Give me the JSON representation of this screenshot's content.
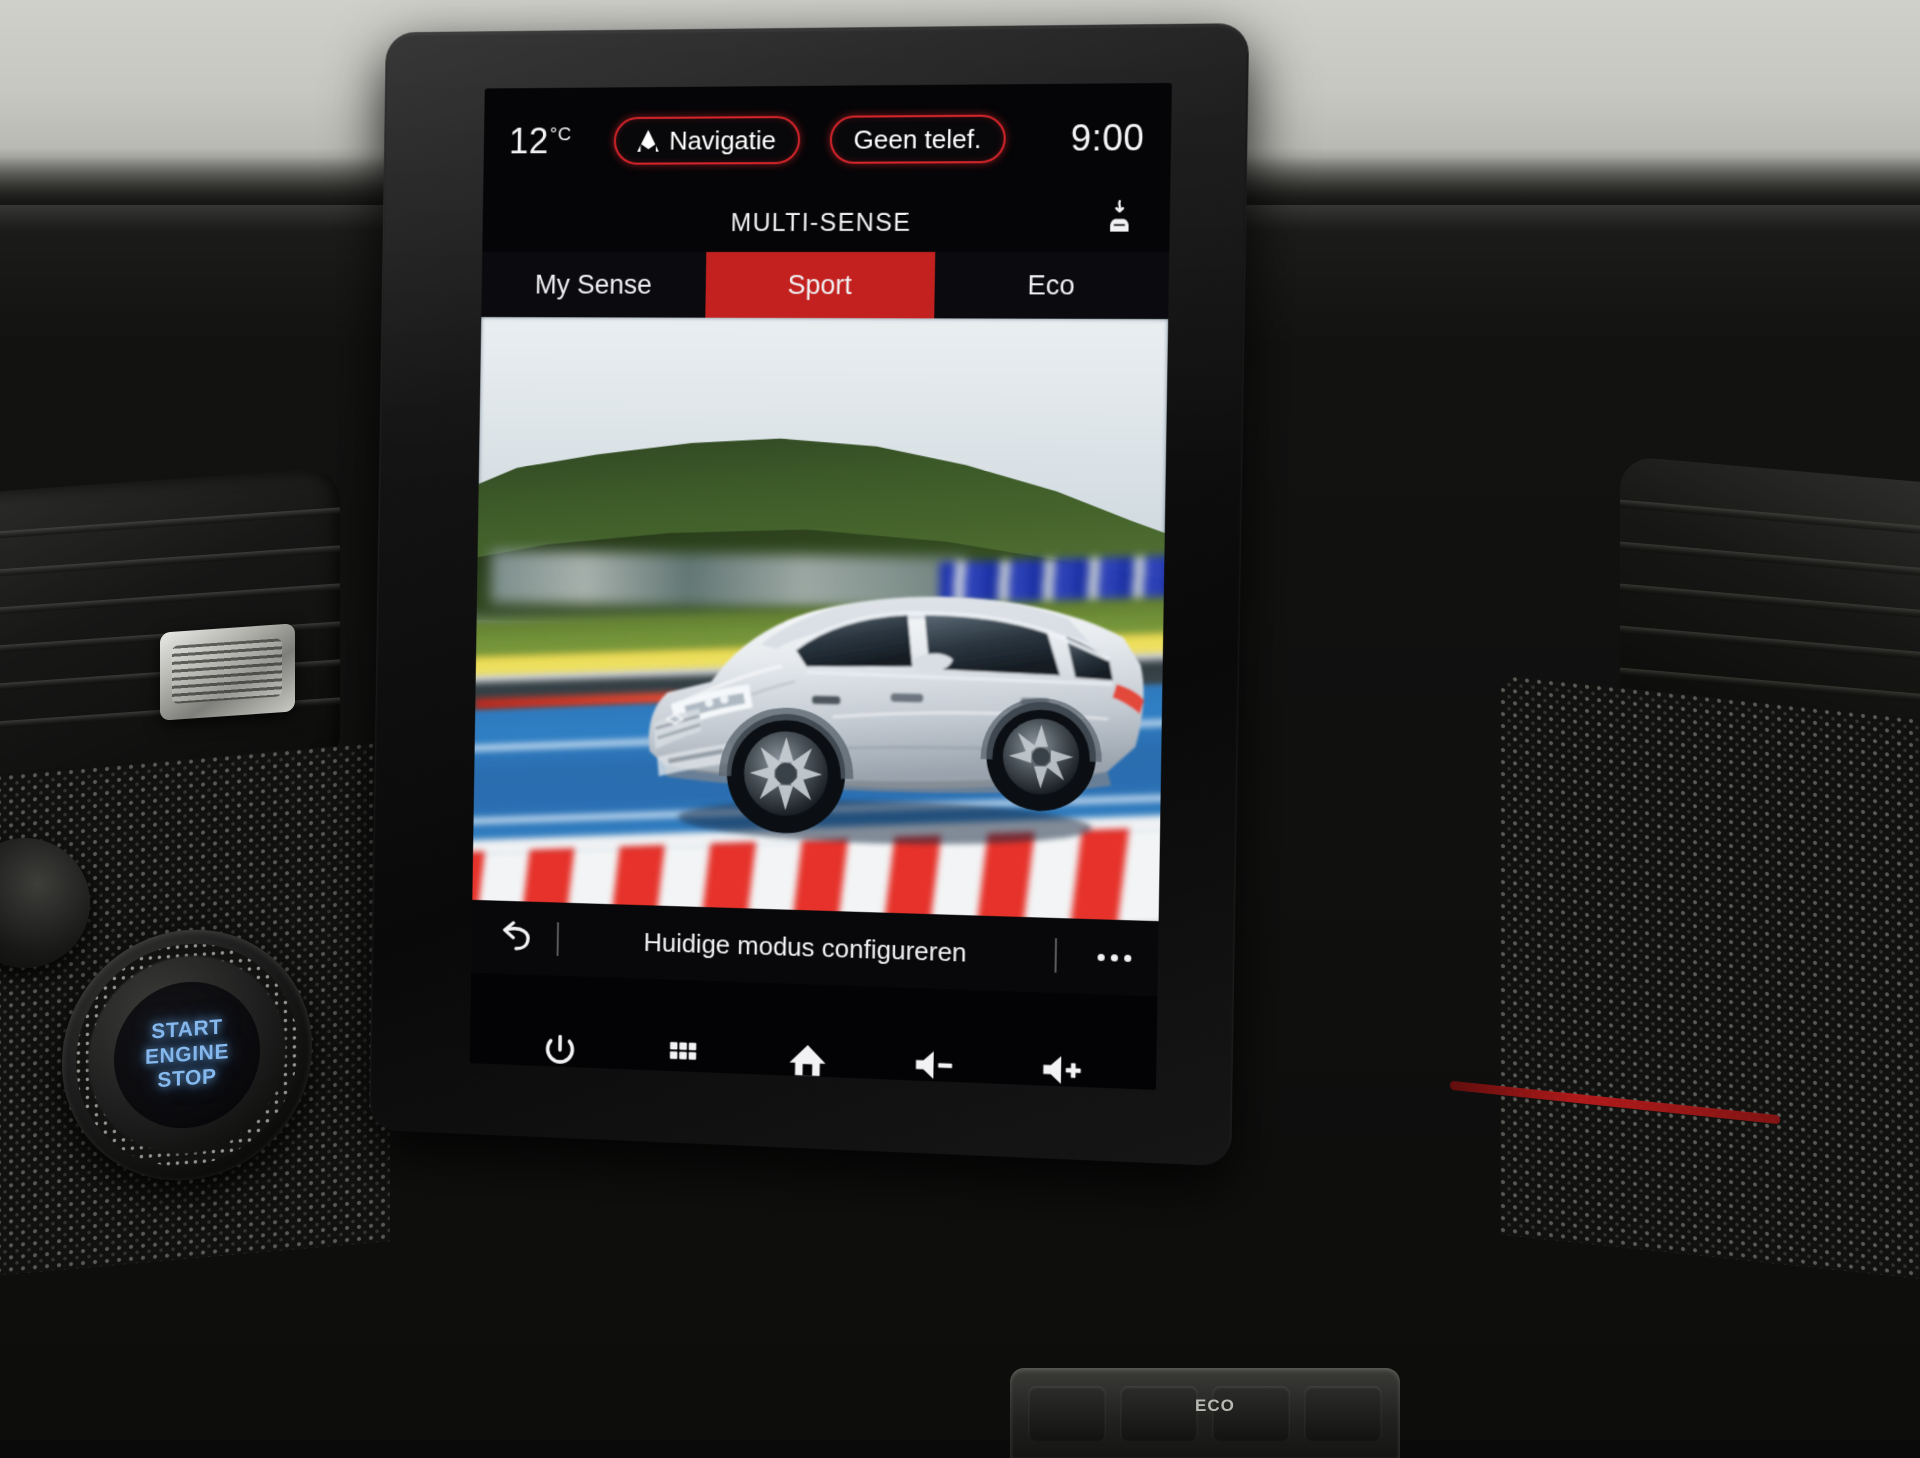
{
  "vehicle_ui": {
    "status_bar": {
      "temperature": "12",
      "temperature_unit": "°C",
      "navigation_pill": {
        "label": "Navigatie",
        "icon": "navigation-arrow-icon"
      },
      "phone_pill": {
        "label": "Geen telef."
      },
      "clock": "9:00"
    },
    "header": {
      "title": "MULTI-SENSE",
      "climate_icon": "climate-airflow-car-icon"
    },
    "tabs": [
      {
        "id": "my-sense",
        "label": "My Sense",
        "active": false
      },
      {
        "id": "sport",
        "label": "Sport",
        "active": true
      },
      {
        "id": "eco",
        "label": "Eco",
        "active": false
      }
    ],
    "hero": {
      "alt": "Renault Arkana silver SUV driving on a race circuit",
      "car_color": "#d9dde2",
      "track_color": "#2f79bd"
    },
    "action_bar": {
      "back_icon": "back-arrow-icon",
      "label": "Huidige modus configureren",
      "more_icon": "more-options-icon"
    },
    "nav_bar": [
      {
        "id": "power",
        "icon": "power-icon"
      },
      {
        "id": "apps",
        "icon": "apps-grid-icon"
      },
      {
        "id": "home",
        "icon": "home-icon"
      },
      {
        "id": "volume-down",
        "icon": "volume-down-icon"
      },
      {
        "id": "volume-up",
        "icon": "volume-up-icon"
      }
    ],
    "colors": {
      "accent_red": "#c3211f",
      "pill_outline": "#d9262c",
      "screen_bg": "#050507",
      "text": "#f2f2f4"
    }
  },
  "dashboard": {
    "start_stop_button": {
      "line1": "START",
      "line2": "ENGINE",
      "line3": "STOP",
      "color": "#86b9ee"
    },
    "console_badge": "ECO"
  }
}
